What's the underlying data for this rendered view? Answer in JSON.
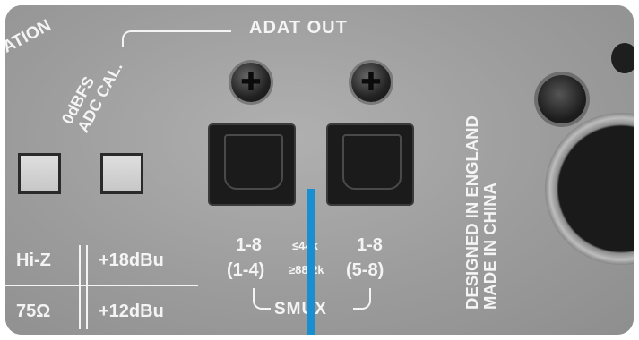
{
  "labels": {
    "adat_out": "ADAT OUT",
    "ation": "ATION",
    "adc_cal_line1": "0dBFS",
    "adc_cal_line2": "ADC CAL.",
    "designed_line1": "DESIGNED IN ENGLAND",
    "designed_line2": "MADE IN CHINA",
    "hiz": "Hi-Z",
    "ohm": "75Ω",
    "dbu_high": "+18dBu",
    "dbu_low": "+12dBu",
    "port1_channels": "1-8",
    "port1_smux": "(1-4)",
    "port2_channels": "1-8",
    "port2_smux": "(5-8)",
    "rate_low": "≤44k",
    "rate_high": "≥88.2k",
    "smux": "SMUX"
  },
  "colors": {
    "panel": "#9c9c9c",
    "text": "#f4f4f4",
    "accent_line": "#1a8fd0"
  }
}
